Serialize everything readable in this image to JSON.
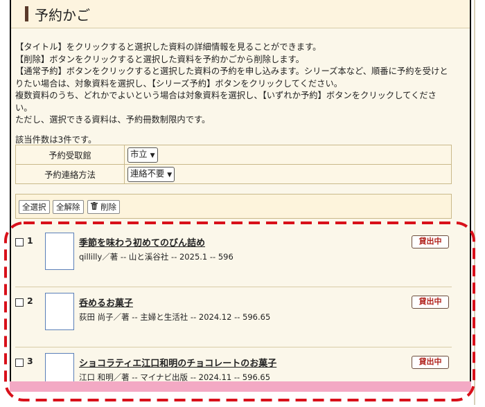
{
  "page": {
    "title": "予約かご"
  },
  "description": [
    "【タイトル】をクリックすると選択した資料の詳細情報を見ることができます。",
    "【削除】ボタンをクリックすると選択した資料を予約かごから削除します。",
    "【通常予約】ボタンをクリックすると選択した資料の予約を申し込みます。シリーズ本など、順番に予約を受けと",
    "りたい場合は、対象資料を選択し、【シリーズ予約】ボタンをクリックしてください。",
    "複数資料のうち、どれかでよいという場合は対象資料を選択し、【いずれか予約】ボタンをクリックしてくださ",
    "い。",
    "ただし、選択できる資料は、予約冊数制限内です。"
  ],
  "result_count": "該当件数は3件です。",
  "options": {
    "pickup_label": "予約受取館",
    "pickup_value": "市立",
    "contact_label": "予約連絡方法",
    "contact_value": "連絡不要"
  },
  "toolbar": {
    "select_all": "全選択",
    "deselect_all": "全解除",
    "delete": "削除"
  },
  "items": [
    {
      "num": "1",
      "title": "季節を味わう初めてのびん詰め",
      "meta": "qillilly／著 -- 山と溪谷社 -- 2025.1 -- 596",
      "status": "貸出中"
    },
    {
      "num": "2",
      "title": "呑めるお菓子",
      "meta": "荻田 尚子／著 -- 主婦と生活社 -- 2024.12 -- 596.65",
      "status": "貸出中"
    },
    {
      "num": "3",
      "title": "ショコラティエ江口和明のチョコレートのお菓子",
      "meta": "江口 和明／著 -- マイナビ出版 -- 2024.11 -- 596.65",
      "status": "貸出中"
    }
  ],
  "colors": {
    "annotation": "#d8101a",
    "status_text": "#b0201a",
    "accent_bar": "#5a3a2a"
  }
}
